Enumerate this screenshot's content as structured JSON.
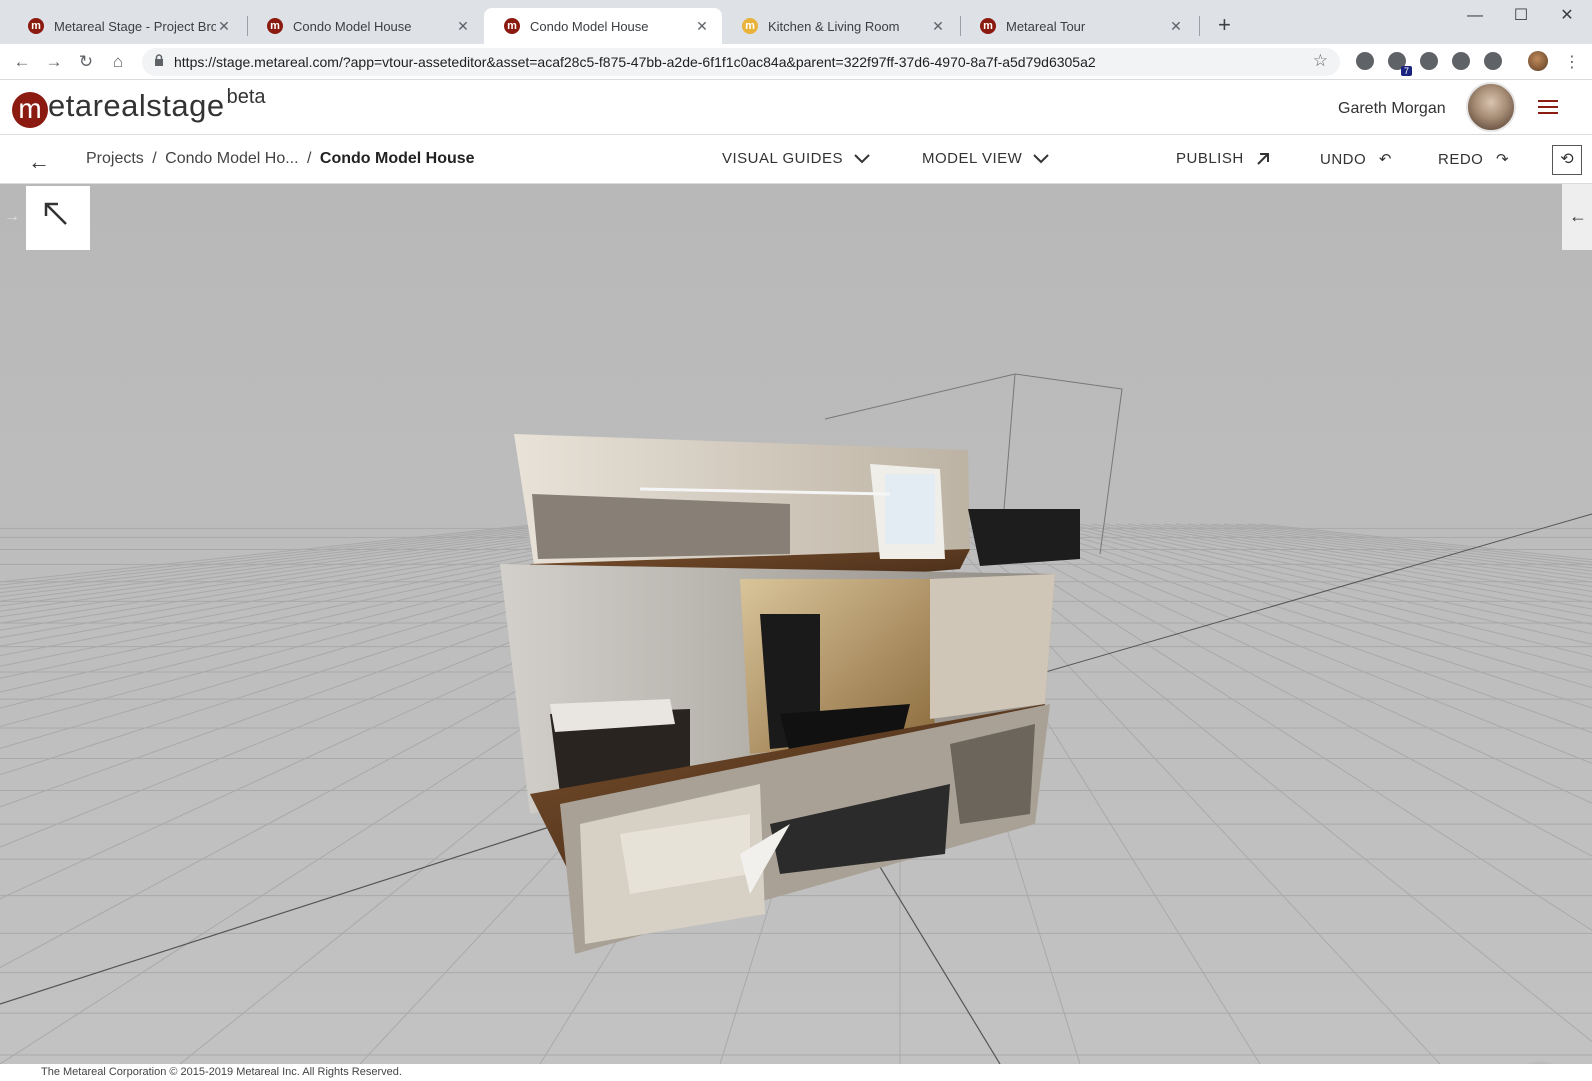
{
  "browser": {
    "tabs": [
      {
        "title": "Metareal Stage - Project Browser",
        "favicon": "m",
        "active": false
      },
      {
        "title": "Condo Model House",
        "favicon": "m",
        "active": false
      },
      {
        "title": "Condo Model House",
        "favicon": "m",
        "active": true
      },
      {
        "title": "Kitchen & Living Room",
        "favicon": "m",
        "active": false
      },
      {
        "title": "Metareal Tour",
        "favicon": "m",
        "active": false
      }
    ],
    "url": "https://stage.metareal.com/?app=vtour-asseteditor&asset=acaf28c5-f875-47bb-a2de-6f1f1c0ac84a&parent=322f97ff-37d6-4970-8a7f-a5d79d6305a2",
    "extension_badge": "7"
  },
  "app": {
    "brand": {
      "mark": "m",
      "wordmark": "etarealstage",
      "beta": "beta"
    },
    "user": {
      "name": "Gareth Morgan"
    },
    "breadcrumb": {
      "root": "Projects",
      "sep": "/",
      "parent": "Condo Model Ho...",
      "current": "Condo Model House"
    },
    "menu": {
      "visual_guides": "VISUAL GUIDES",
      "model_view": "MODEL VIEW",
      "publish": "PUBLISH",
      "undo": "UNDO",
      "redo": "REDO"
    },
    "footer": "The Metareal Corporation © 2015-2019 Metareal Inc. All Rights Reserved."
  },
  "colors": {
    "brand_red": "#8b1a10",
    "chat_red": "#b3261e"
  },
  "icons": [
    "back-arrow-icon",
    "chevron-down-icon",
    "arrow-up-right-icon",
    "undo-icon",
    "redo-icon",
    "sync-icon",
    "collapse-arrow-icon",
    "chat-icon",
    "menu-icon",
    "star-icon",
    "lock-icon"
  ]
}
